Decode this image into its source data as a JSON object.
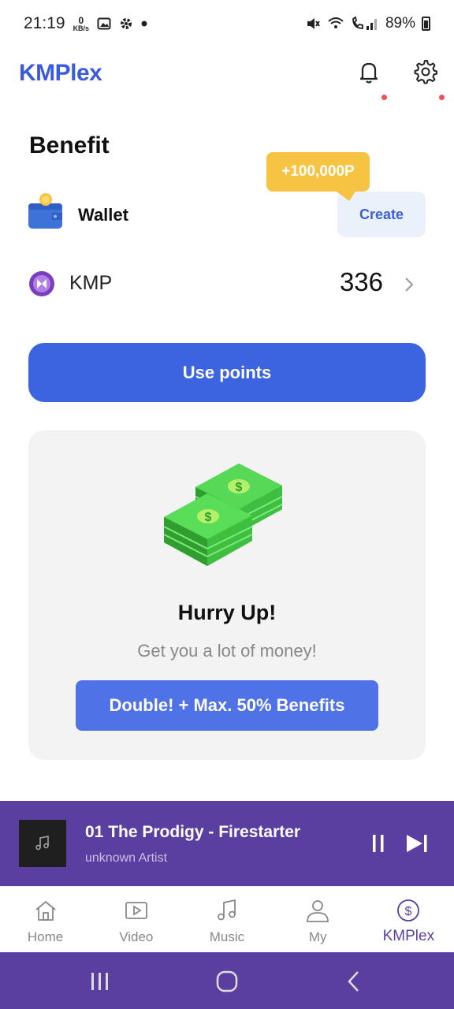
{
  "status_bar": {
    "time": "21:19",
    "speed_value": "0",
    "speed_unit": "KB/s",
    "battery": "89%"
  },
  "header": {
    "logo": "KMPlex",
    "icons": [
      "bell-icon",
      "gear-icon"
    ]
  },
  "benefit": {
    "title": "Benefit",
    "wallet_label": "Wallet",
    "create_label": "Create",
    "bonus_tooltip": "+100,000P",
    "kmp_label": "KMP",
    "kmp_value": "336",
    "use_points_label": "Use points"
  },
  "promo": {
    "title": "Hurry Up!",
    "subtitle": "Get you a lot of money!",
    "button_label": "Double! + Max. 50% Benefits"
  },
  "player": {
    "track_title": "01 The Prodigy - Firestarter",
    "artist": "unknown Artist"
  },
  "bottom_nav": {
    "items": [
      {
        "label": "Home",
        "icon": "home-icon"
      },
      {
        "label": "Video",
        "icon": "video-icon"
      },
      {
        "label": "Music",
        "icon": "music-icon"
      },
      {
        "label": "My",
        "icon": "user-icon"
      },
      {
        "label": "KMPlex",
        "icon": "dollar-icon"
      }
    ],
    "active_index": 4
  },
  "colors": {
    "brand": "#3b5bdb",
    "primary_button": "#3d64e0",
    "player_bg": "#5b3fa0",
    "tooltip": "#f6c343"
  }
}
